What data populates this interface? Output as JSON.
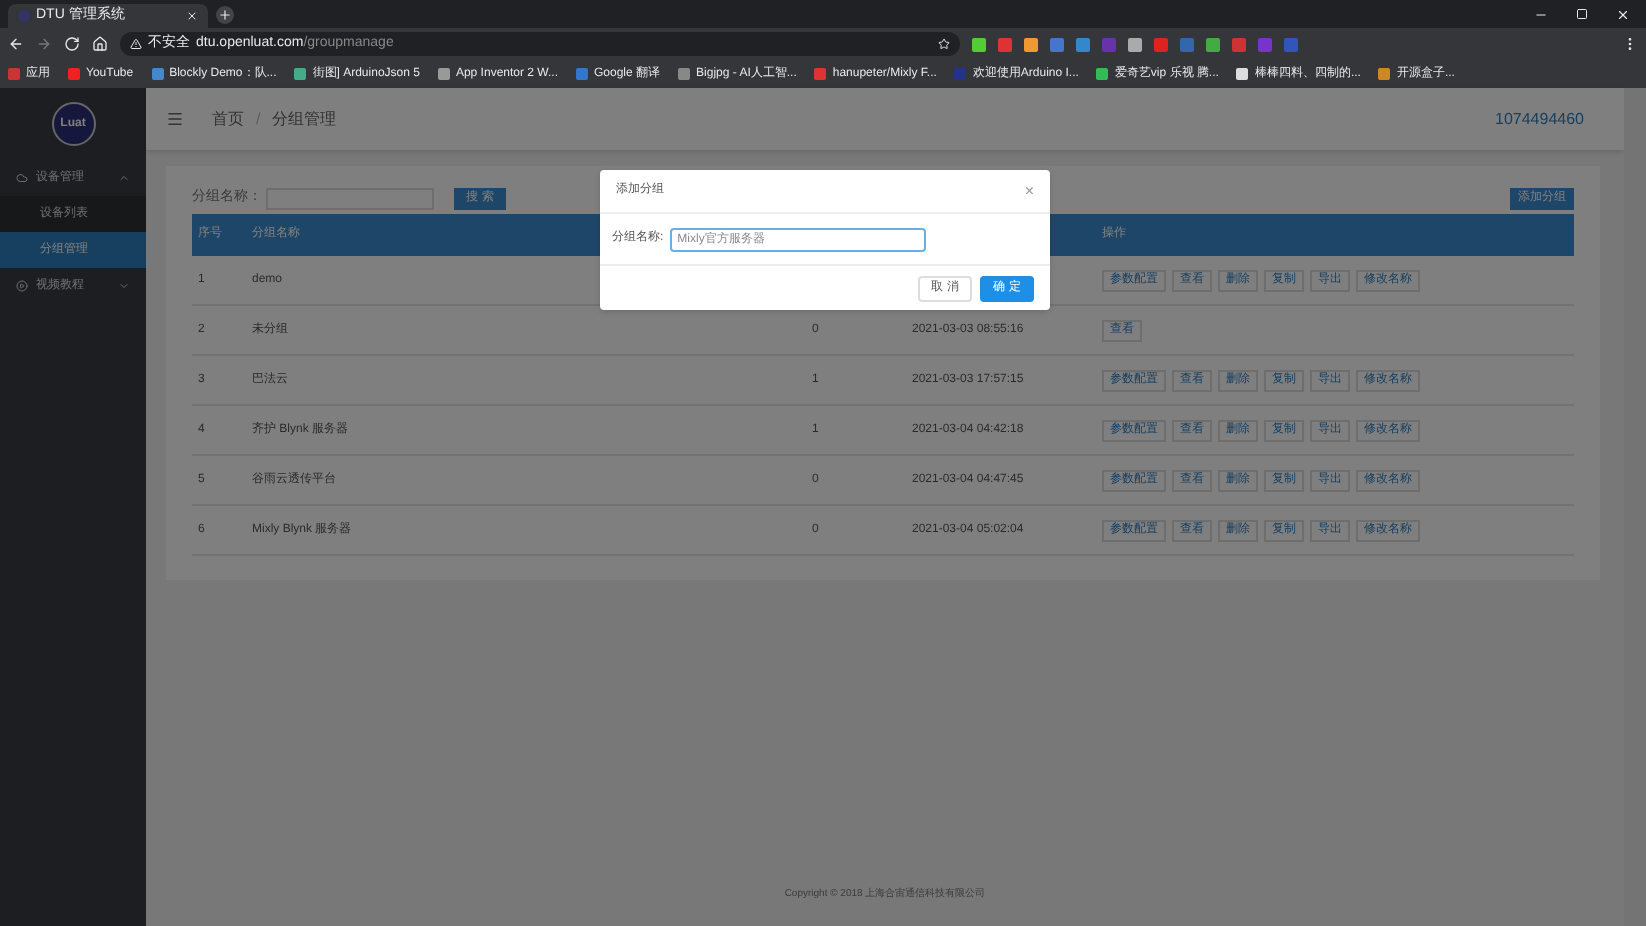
{
  "browser": {
    "tab_title": "DTU 管理系统",
    "security": "不安全",
    "url_host": "dtu.openluat.com",
    "url_path": "/groupmanage",
    "bookmarks": [
      "应用",
      "YouTube",
      "Blockly Demo：队...",
      "街图] ArduinoJson 5",
      "App Inventor 2 W...",
      "Google 翻译",
      "Bigjpg - AI人工智...",
      "hanupeter/Mixly F...",
      "欢迎使用Arduino I...",
      "爱奇艺vip 乐视 腾...",
      "棒棒四料、四制的...",
      "开源盒子..."
    ]
  },
  "sidebar": {
    "logo": "Luat",
    "items": [
      {
        "label": "设备管理",
        "expanded": true,
        "children": [
          {
            "label": "设备列表",
            "selected": false
          },
          {
            "label": "分组管理",
            "selected": true
          }
        ]
      },
      {
        "label": "视频教程",
        "expanded": false
      }
    ]
  },
  "header": {
    "breadcrumb": [
      "首页",
      "分组管理"
    ],
    "separator": "/",
    "user": "1074494460"
  },
  "toolbar": {
    "search_label": "分组名称：",
    "search_button": "搜 索",
    "add_button": "添加分组"
  },
  "table": {
    "columns": {
      "index": "序号",
      "name": "分组名称",
      "actions": "操作"
    },
    "rows": [
      {
        "index": "1",
        "name": "demo",
        "actions": [
          "参数配置",
          "查看",
          "删除",
          "复制",
          "导出",
          "修改名称"
        ]
      },
      {
        "index": "2",
        "name": "未分组",
        "count": "0",
        "time": "2021-03-03 08:55:16",
        "actions": [
          "查看"
        ]
      },
      {
        "index": "3",
        "name": "巴法云",
        "count": "1",
        "time": "2021-03-03 17:57:15",
        "actions": [
          "参数配置",
          "查看",
          "删除",
          "复制",
          "导出",
          "修改名称"
        ]
      },
      {
        "index": "4",
        "name": "齐护 Blynk 服务器",
        "count": "1",
        "time": "2021-03-04 04:42:18",
        "actions": [
          "参数配置",
          "查看",
          "删除",
          "复制",
          "导出",
          "修改名称"
        ]
      },
      {
        "index": "5",
        "name": "谷雨云透传平台",
        "count": "0",
        "time": "2021-03-04 04:47:45",
        "actions": [
          "参数配置",
          "查看",
          "删除",
          "复制",
          "导出",
          "修改名称"
        ]
      },
      {
        "index": "6",
        "name": "Mixly Blynk 服务器",
        "count": "0",
        "time": "2021-03-04 05:02:04",
        "actions": [
          "参数配置",
          "查看",
          "删除",
          "复制",
          "导出",
          "修改名称"
        ]
      }
    ]
  },
  "footer": "Copyright © 2018 上海合宙通信科技有限公司",
  "dialog": {
    "title": "添加分组",
    "close": "×",
    "field_label": "分组名称:",
    "field_value": "Mixly官方服务器",
    "buttons": [
      {
        "label": "取 消",
        "kind": "secondary"
      },
      {
        "label": "确 定",
        "kind": "primary"
      }
    ]
  }
}
